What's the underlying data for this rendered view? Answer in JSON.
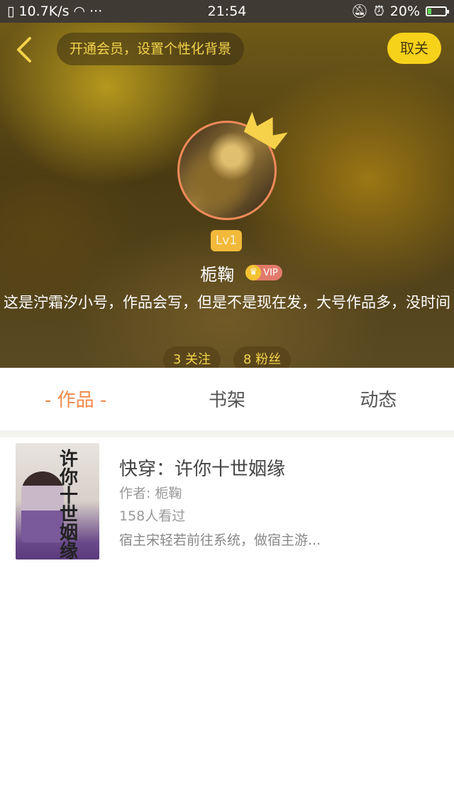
{
  "status_bar": {
    "network_speed": "10.7K/s",
    "more": "···",
    "time": "21:54",
    "battery": "20%",
    "battery_level": 0.2
  },
  "header": {
    "vip_banner": "开通会员，设置个性化背景",
    "unfollow_label": "取关",
    "level": "Lv1",
    "username": "栀鞠",
    "vip_label": "VIP",
    "bio": "这是泞霜汐小号，作品会写，但是不是现在发，大号作品多，没时间",
    "following": "3 关注",
    "followers": "8 粉丝"
  },
  "tabs": [
    {
      "label": "- 作品 -",
      "active": true
    },
    {
      "label": "书架",
      "active": false
    },
    {
      "label": "动态",
      "active": false
    }
  ],
  "books": [
    {
      "title": "快穿：许你十世姻缘",
      "author": "作者: 栀鞠",
      "views": "158人看过",
      "description": "宿主宋轻若前往系统，做宿主游...",
      "cover_title": "许你十世姻缘"
    }
  ],
  "colors": {
    "accent": "#f08a4a",
    "gold": "#f4d44c",
    "unfollow_bg": "#f7d21b"
  }
}
